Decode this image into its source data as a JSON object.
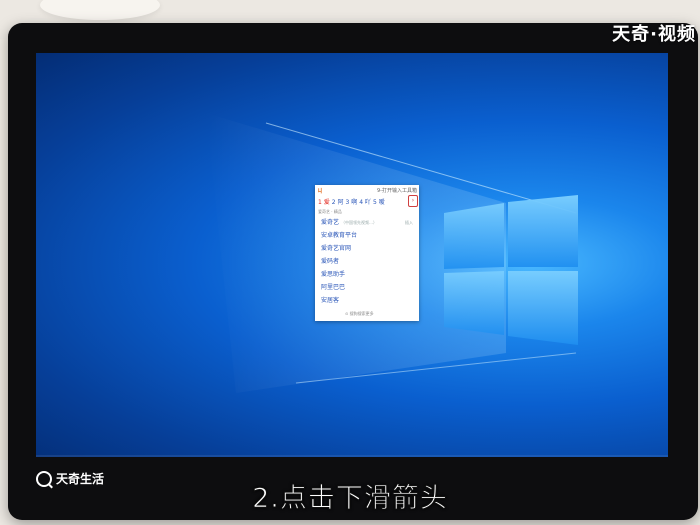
{
  "watermark_top": "天奇·视频",
  "watermark_bottom": "天奇生活",
  "caption": "2.点击下滑箭头",
  "ime": {
    "logo": "ㄐ",
    "title": "9-打开输入工具箱",
    "candidates": [
      "1 爱",
      "2 阿",
      "3 啊",
      "4 吖",
      "5 嗳"
    ],
    "arrow": "›",
    "hint": "爱奇艺 · 精品",
    "list": [
      {
        "text": "爱奇艺",
        "note": "（中国领先视频…）",
        "ins": "插入"
      },
      {
        "text": "安卓教育平台",
        "note": "",
        "ins": ""
      },
      {
        "text": "爱奇艺官网",
        "note": "",
        "ins": ""
      },
      {
        "text": "爱码者",
        "note": "",
        "ins": ""
      },
      {
        "text": "爱思助手",
        "note": "",
        "ins": ""
      },
      {
        "text": "阿里巴巴",
        "note": "",
        "ins": ""
      },
      {
        "text": "安居客",
        "note": "",
        "ins": ""
      }
    ],
    "footer": "⊙ 搜狗搜索更多"
  },
  "colors": {
    "screen_bg": "#0a5fcf",
    "window_logo": "#4fb3ff",
    "candidate_selected": "#e2231a",
    "candidate": "#2a56b8"
  }
}
